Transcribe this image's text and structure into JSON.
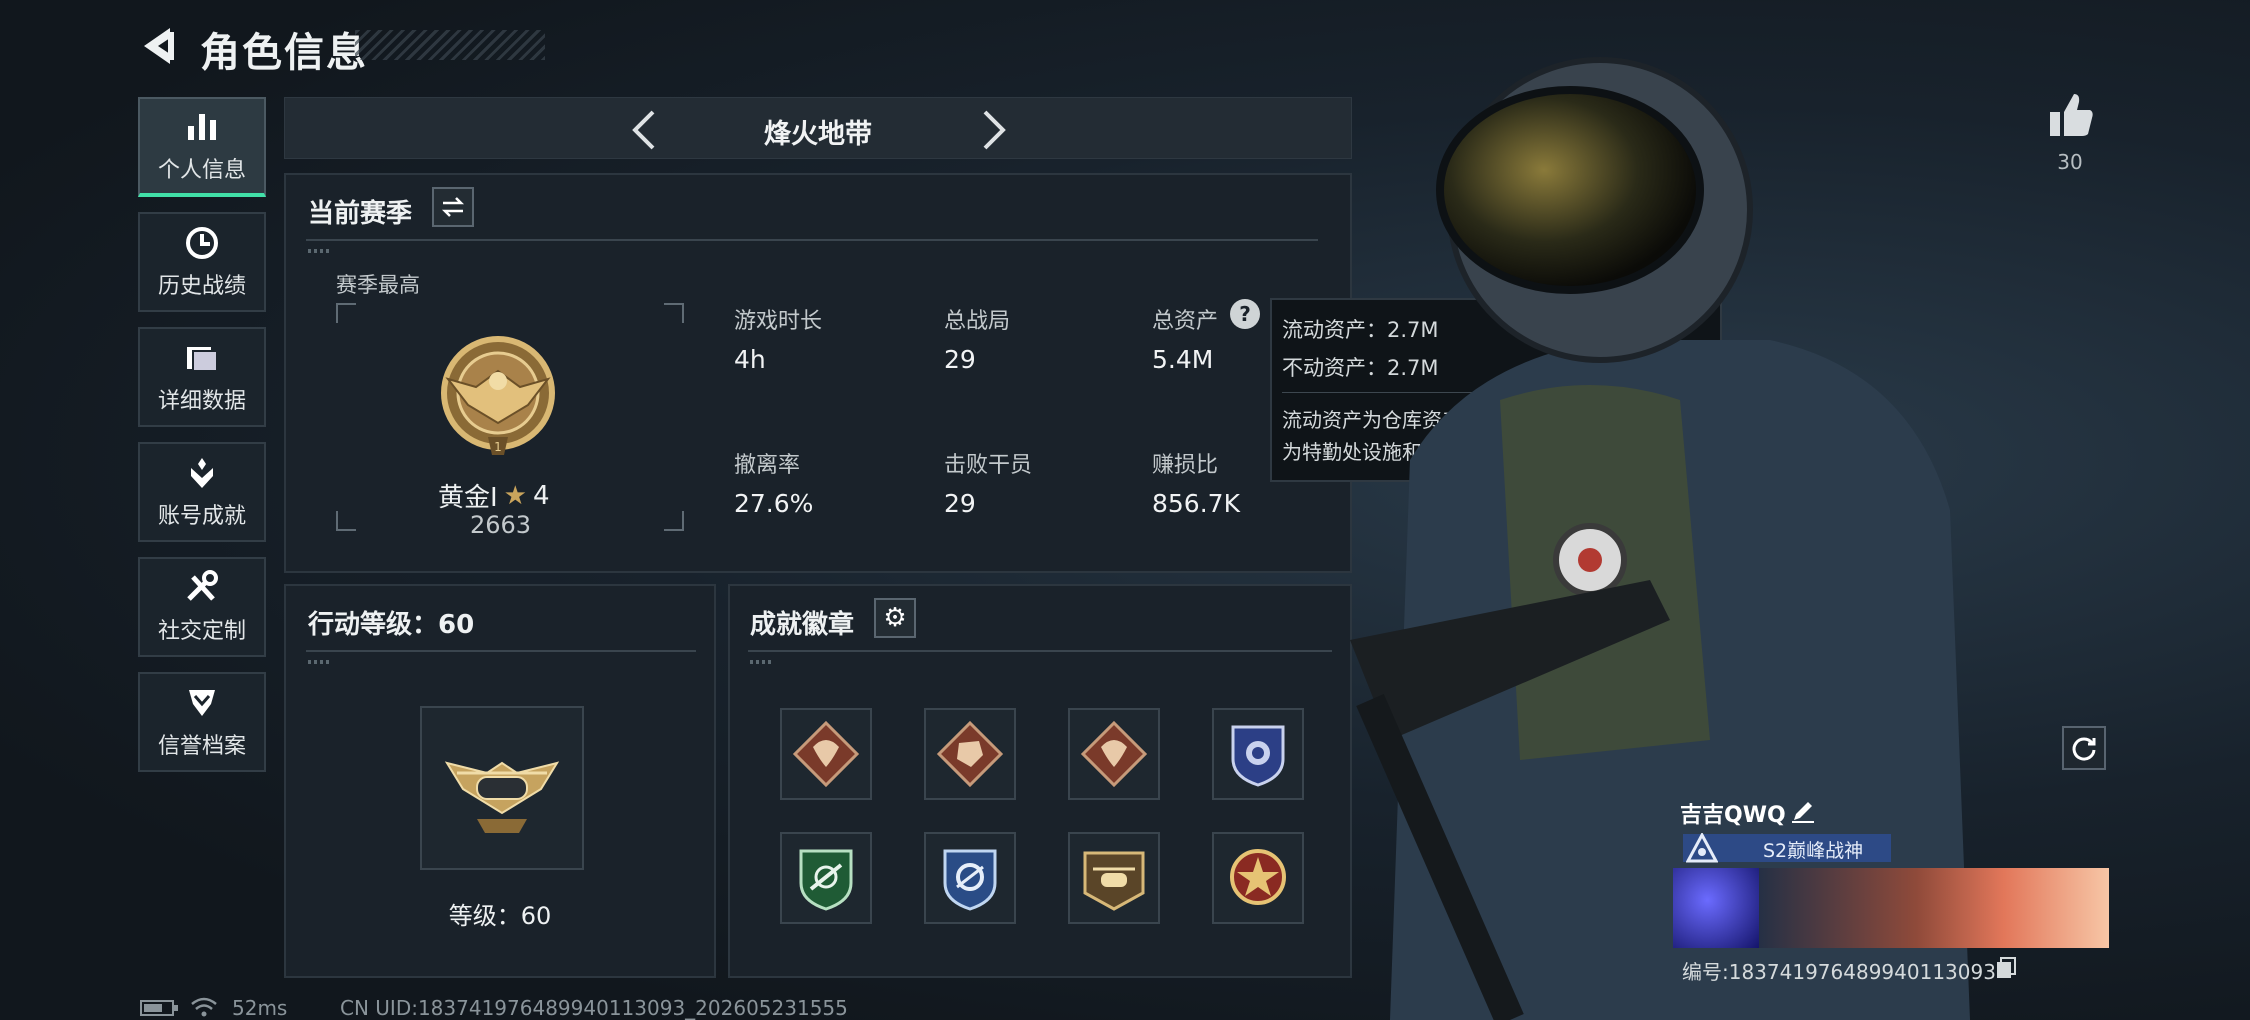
{
  "header": {
    "title": "角色信息"
  },
  "sidebar": {
    "items": [
      {
        "label": "个人信息",
        "icon": "bar-chart-icon",
        "active": true
      },
      {
        "label": "历史战绩",
        "icon": "history-clock-icon"
      },
      {
        "label": "详细数据",
        "icon": "folder-icon"
      },
      {
        "label": "账号成就",
        "icon": "achievement-icon"
      },
      {
        "label": "社交定制",
        "icon": "tools-icon"
      },
      {
        "label": "信誉档案",
        "icon": "shield-chevron-icon"
      }
    ]
  },
  "mode": {
    "label": "烽火地带"
  },
  "season": {
    "title": "当前赛季",
    "best_label": "赛季最高",
    "rank_name": "黄金Ⅰ",
    "rank_stars": "4",
    "rank_score": "2663",
    "stats": [
      {
        "label": "游戏时长",
        "value": "4h"
      },
      {
        "label": "总战局",
        "value": "29"
      },
      {
        "label": "总资产",
        "value": "5.4M"
      },
      {
        "label": "撤离率",
        "value": "27.6%"
      },
      {
        "label": "击败干员",
        "value": "29"
      },
      {
        "label": "赚损比",
        "value": "856.7K"
      }
    ]
  },
  "tooltip": {
    "line1": "流动资产：2.7M",
    "line2": "不动资产：2.7M",
    "desc1": "流动资产为仓库资产和哈夫币，不动资产",
    "desc2": "为特勤处设施和收藏室设施"
  },
  "action_level": {
    "title": "行动等级：60",
    "level_text": "等级：60"
  },
  "badges": {
    "title": "成就徽章",
    "items": [
      "dragon-badge-icon",
      "fist-badge-icon",
      "dragon-badge-icon",
      "police-badge-icon",
      "green-shield-badge-icon",
      "blue-shield-badge-icon",
      "helicopter-badge-icon",
      "star-emblem-badge-icon"
    ]
  },
  "likes": {
    "count": "30"
  },
  "player": {
    "name": "吉吉QWQ",
    "rank_title": "S2巅峰战神",
    "id_text": "编号:183741976489940113093"
  },
  "footer": {
    "ping": "52ms",
    "uid": "CN UID:183741976489940113093_202605231555"
  },
  "colors": {
    "accent": "#41e0a8",
    "gold": "#c9a45c",
    "rank_bar": "#2d4a86"
  }
}
